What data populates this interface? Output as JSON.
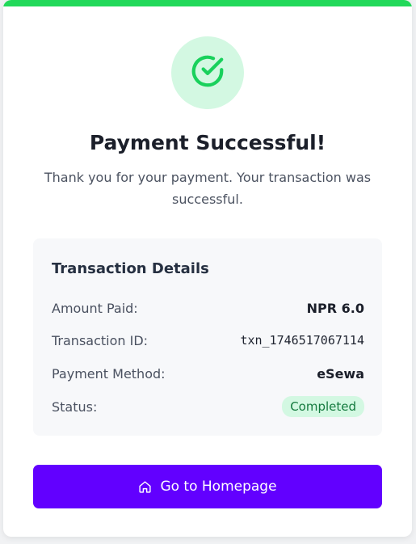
{
  "colors": {
    "accent_green": "#22d95a",
    "success_bg": "#d3f8e2",
    "primary_button": "#6200ff"
  },
  "header": {
    "icon": "check-circle-icon",
    "title": "Payment Successful!",
    "subtitle": "Thank you for your payment. Your transaction was successful."
  },
  "details": {
    "heading": "Transaction Details",
    "rows": [
      {
        "label": "Amount Paid:",
        "value": "NPR 6.0"
      },
      {
        "label": "Transaction ID:",
        "value": "txn_1746517067114"
      },
      {
        "label": "Payment Method:",
        "value": "eSewa"
      },
      {
        "label": "Status:",
        "value": "Completed"
      }
    ]
  },
  "action": {
    "icon": "home-icon",
    "label": "Go to Homepage"
  }
}
